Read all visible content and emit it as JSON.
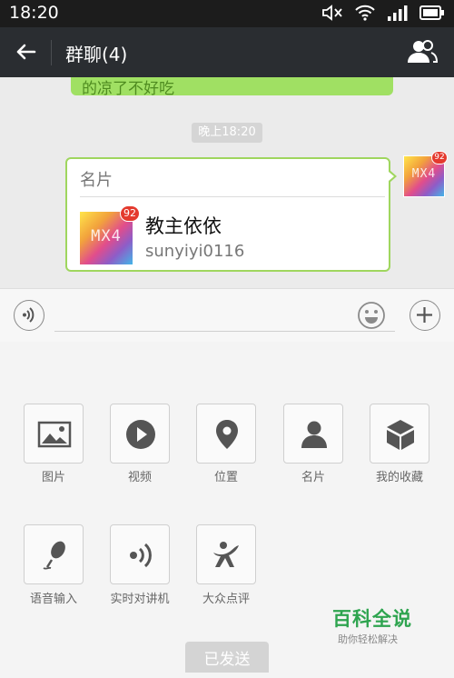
{
  "status_bar": {
    "time": "18:20",
    "icons": [
      "mute-icon",
      "wifi-icon",
      "signal-icon",
      "battery-icon"
    ]
  },
  "header": {
    "title": "群聊(4)",
    "back_icon": "back-arrow-icon",
    "contacts_icon": "group-contacts-icon"
  },
  "chat": {
    "previous_message_text": "的凉了不好吃",
    "timestamp": "晚上18:20",
    "card_message": {
      "header_label": "名片",
      "contact_name": "教主依依",
      "contact_id": "sunyiyi0116",
      "avatar_text": "MX4",
      "avatar_badge": "92"
    },
    "self_avatar": {
      "text": "MX4",
      "badge": "92"
    }
  },
  "input_bar": {
    "voice_icon": "voice-icon",
    "emoji_icon": "emoji-icon",
    "plus_icon": "plus-icon"
  },
  "attachments": [
    {
      "label": "图片",
      "icon": "image-icon"
    },
    {
      "label": "视频",
      "icon": "video-icon"
    },
    {
      "label": "位置",
      "icon": "location-icon"
    },
    {
      "label": "名片",
      "icon": "contact-card-icon"
    },
    {
      "label": "我的收藏",
      "icon": "favorites-icon"
    },
    {
      "label": "语音输入",
      "icon": "microphone-icon"
    },
    {
      "label": "实时对讲机",
      "icon": "walkie-talkie-icon"
    },
    {
      "label": "大众点评",
      "icon": "dianping-icon"
    }
  ],
  "watermark": {
    "title": "百科全说",
    "subtitle": "助你轻松解决"
  },
  "toast": {
    "text": "已发送"
  },
  "colors": {
    "accent_green": "#9fd65e",
    "bubble_green": "#a0e063",
    "badge_red": "#e43a2e",
    "titlebar": "#2a2d31"
  }
}
